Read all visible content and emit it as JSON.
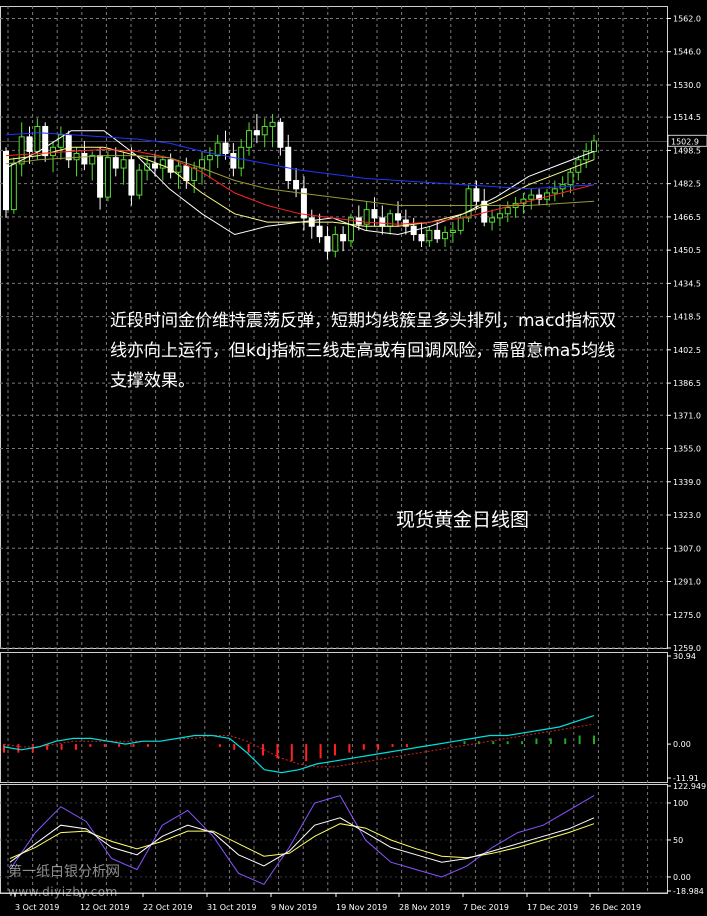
{
  "text": {
    "commentary": "近段时间金价维持震荡反弹，短期均线簇呈多头排列，macd指标双线亦向上运行，但kdj指标三线走高或有回调风险，需留意ma5均线支撑效果。",
    "caption": "现货黄金日线图",
    "watermark_name": "第一纸白银分析网",
    "watermark_url": "www.diyizby.com"
  },
  "colors": {
    "background": "#000000",
    "grid": "#7a7a7a",
    "bull_candle": "#55dd33",
    "bear_candle": "#ffffff",
    "ma_fast": "#ffffff",
    "ma_yellow": "#ffff88",
    "ma_red": "#ff2222",
    "ma_blue": "#2233ff",
    "ma_olive": "#999933",
    "macd_hist": "#ff2222",
    "macd_line": "#00e0e0",
    "macd_signal": "#cc2222",
    "kdj_k": "#ffffff",
    "kdj_d": "#ffff66",
    "kdj_j": "#8855ff"
  },
  "chart_data": [
    {
      "type": "candlestick",
      "panel": "price",
      "y_ticks": [
        "1562.0",
        "1546.0",
        "1530.0",
        "1514.5",
        "1498.5",
        "1482.5",
        "1466.5",
        "1450.5",
        "1434.5",
        "1418.5",
        "1402.5",
        "1386.5",
        "1371.0",
        "1355.0",
        "1339.0",
        "1323.0",
        "1307.0",
        "1291.0",
        "1275.0",
        "1259.0"
      ],
      "ylim": [
        1259.0,
        1568.0
      ],
      "current_price_label": "1502.9",
      "x_labels": [
        "3 Oct 2019",
        "12 Oct 2019",
        "22 Oct 2019",
        "31 Oct 2019",
        "9 Nov 2019",
        "19 Nov 2019",
        "28 Nov 2019",
        "7 Dec 2019",
        "17 Dec 2019",
        "26 Dec 2019"
      ],
      "candles": [
        [
          1498,
          1500,
          1466,
          1470
        ],
        [
          1470,
          1495,
          1468,
          1492
        ],
        [
          1492,
          1512,
          1486,
          1505
        ],
        [
          1505,
          1510,
          1492,
          1498
        ],
        [
          1498,
          1514,
          1494,
          1510
        ],
        [
          1510,
          1512,
          1493,
          1496
        ],
        [
          1496,
          1503,
          1488,
          1500
        ],
        [
          1500,
          1510,
          1494,
          1506
        ],
        [
          1506,
          1508,
          1490,
          1494
        ],
        [
          1494,
          1500,
          1486,
          1497
        ],
        [
          1497,
          1503,
          1489,
          1492
        ],
        [
          1492,
          1498,
          1484,
          1496
        ],
        [
          1496,
          1500,
          1470,
          1476
        ],
        [
          1476,
          1498,
          1474,
          1495
        ],
        [
          1495,
          1500,
          1486,
          1490
        ],
        [
          1490,
          1498,
          1482,
          1494
        ],
        [
          1494,
          1500,
          1472,
          1477
        ],
        [
          1477,
          1492,
          1475,
          1489
        ],
        [
          1489,
          1496,
          1484,
          1492
        ],
        [
          1492,
          1497,
          1486,
          1490
        ],
        [
          1490,
          1496,
          1484,
          1494
        ],
        [
          1494,
          1497,
          1485,
          1488
        ],
        [
          1488,
          1494,
          1480,
          1491
        ],
        [
          1491,
          1495,
          1480,
          1484
        ],
        [
          1484,
          1493,
          1478,
          1490
        ],
        [
          1490,
          1498,
          1482,
          1494
        ],
        [
          1494,
          1500,
          1485,
          1496
        ],
        [
          1496,
          1506,
          1490,
          1502
        ],
        [
          1502,
          1508,
          1494,
          1497
        ],
        [
          1497,
          1502,
          1486,
          1490
        ],
        [
          1490,
          1504,
          1486,
          1500
        ],
        [
          1500,
          1512,
          1496,
          1508
        ],
        [
          1508,
          1516,
          1502,
          1506
        ],
        [
          1506,
          1514,
          1500,
          1510
        ],
        [
          1510,
          1516,
          1500,
          1512
        ],
        [
          1512,
          1514,
          1496,
          1500
        ],
        [
          1500,
          1506,
          1480,
          1484
        ],
        [
          1484,
          1490,
          1476,
          1480
        ],
        [
          1480,
          1486,
          1460,
          1466
        ],
        [
          1466,
          1470,
          1456,
          1462
        ],
        [
          1462,
          1468,
          1454,
          1457
        ],
        [
          1457,
          1462,
          1446,
          1450
        ],
        [
          1450,
          1462,
          1447,
          1458
        ],
        [
          1458,
          1462,
          1450,
          1455
        ],
        [
          1455,
          1468,
          1452,
          1466
        ],
        [
          1466,
          1472,
          1460,
          1463
        ],
        [
          1463,
          1474,
          1460,
          1470
        ],
        [
          1470,
          1476,
          1462,
          1466
        ],
        [
          1466,
          1472,
          1458,
          1462
        ],
        [
          1462,
          1470,
          1458,
          1468
        ],
        [
          1468,
          1474,
          1462,
          1465
        ],
        [
          1465,
          1470,
          1458,
          1462
        ],
        [
          1462,
          1466,
          1455,
          1458
        ],
        [
          1458,
          1464,
          1452,
          1455
        ],
        [
          1455,
          1462,
          1452,
          1460
        ],
        [
          1460,
          1464,
          1454,
          1456
        ],
        [
          1456,
          1462,
          1452,
          1459
        ],
        [
          1459,
          1464,
          1454,
          1460
        ],
        [
          1460,
          1468,
          1458,
          1466
        ],
        [
          1466,
          1482,
          1464,
          1480
        ],
        [
          1480,
          1484,
          1470,
          1474
        ],
        [
          1474,
          1480,
          1462,
          1464
        ],
        [
          1464,
          1470,
          1460,
          1466
        ],
        [
          1466,
          1472,
          1462,
          1468
        ],
        [
          1468,
          1474,
          1464,
          1471
        ],
        [
          1471,
          1476,
          1466,
          1473
        ],
        [
          1473,
          1478,
          1468,
          1475
        ],
        [
          1475,
          1480,
          1470,
          1477
        ],
        [
          1477,
          1480,
          1472,
          1475
        ],
        [
          1475,
          1480,
          1472,
          1478
        ],
        [
          1478,
          1484,
          1474,
          1480
        ],
        [
          1480,
          1486,
          1476,
          1482
        ],
        [
          1482,
          1490,
          1478,
          1488
        ],
        [
          1488,
          1496,
          1484,
          1494
        ],
        [
          1494,
          1502,
          1490,
          1498
        ],
        [
          1498,
          1506,
          1494,
          1503
        ]
      ],
      "moving_averages": [
        {
          "color_key": "ma_fast",
          "values": [
            1490,
            1498,
            1508,
            1508,
            1496,
            1480,
            1468,
            1458,
            1462,
            1464,
            1466,
            1460,
            1458,
            1462,
            1468,
            1476,
            1486,
            1492,
            1498
          ]
        },
        {
          "color_key": "ma_yellow",
          "values": [
            1494,
            1496,
            1500,
            1500,
            1496,
            1490,
            1478,
            1468,
            1464,
            1464,
            1464,
            1462,
            1462,
            1464,
            1468,
            1474,
            1482,
            1488,
            1494
          ]
        },
        {
          "color_key": "ma_red",
          "values": [
            1496,
            1497,
            1498,
            1499,
            1498,
            1495,
            1488,
            1478,
            1472,
            1468,
            1466,
            1464,
            1463,
            1464,
            1466,
            1470,
            1474,
            1478,
            1482
          ]
        },
        {
          "color_key": "ma_olive",
          "values": [
            1492,
            1494,
            1495,
            1496,
            1496,
            1495,
            1490,
            1484,
            1480,
            1478,
            1476,
            1474,
            1472,
            1472,
            1472,
            1472,
            1472,
            1473,
            1474
          ]
        },
        {
          "color_key": "ma_blue",
          "values": [
            1506,
            1507,
            1506,
            1505,
            1504,
            1502,
            1498,
            1495,
            1492,
            1489,
            1487,
            1485,
            1484,
            1483,
            1482,
            1481,
            1480,
            1481,
            1482
          ]
        }
      ]
    },
    {
      "type": "line",
      "panel": "macd",
      "y_ticks": [
        "30.94",
        "0.00",
        "-11.91"
      ],
      "ylim": [
        -11.91,
        30.94
      ],
      "histogram": [
        -3,
        -3,
        -3,
        -2,
        -2,
        -2,
        -1,
        -1,
        -1,
        -1,
        -1,
        0,
        0,
        0,
        0,
        -1,
        -2,
        -3,
        -4,
        -5,
        -6,
        -6,
        -5,
        -4,
        -3,
        -2,
        -2,
        -1,
        -1,
        0,
        0,
        0,
        1,
        1,
        1,
        1,
        1,
        2,
        2,
        2,
        3,
        3
      ],
      "macd_line": [
        -1,
        -2,
        -1,
        1,
        2,
        2,
        1,
        0,
        1,
        1,
        2,
        3,
        3,
        2,
        -3,
        -9,
        -10,
        -9,
        -7,
        -6,
        -5,
        -4,
        -3,
        -2,
        -1,
        0,
        1,
        2,
        3,
        3,
        4,
        5,
        6,
        8,
        10
      ],
      "signal_line": [
        0,
        -1,
        -1,
        0,
        1,
        1,
        1,
        1,
        1,
        1,
        2,
        2,
        3,
        3,
        1,
        -2,
        -5,
        -7,
        -8,
        -8,
        -7,
        -6,
        -5,
        -4,
        -3,
        -2,
        -1,
        0,
        1,
        2,
        3,
        4,
        5,
        6,
        7
      ]
    },
    {
      "type": "line",
      "panel": "kdj",
      "y_ticks": [
        "122.949",
        "100",
        "50",
        "0.00",
        "-18.984"
      ],
      "ylim": [
        -18.984,
        122.949
      ],
      "k": [
        20,
        45,
        70,
        65,
        40,
        30,
        55,
        70,
        60,
        30,
        15,
        35,
        70,
        80,
        60,
        40,
        30,
        20,
        25,
        35,
        45,
        55,
        65,
        80
      ],
      "d": [
        25,
        40,
        60,
        62,
        48,
        38,
        48,
        62,
        62,
        45,
        28,
        32,
        55,
        72,
        66,
        50,
        38,
        28,
        26,
        32,
        40,
        50,
        60,
        72
      ],
      "j": [
        10,
        60,
        95,
        75,
        25,
        10,
        70,
        90,
        55,
        5,
        -10,
        40,
        100,
        110,
        50,
        20,
        10,
        0,
        15,
        40,
        60,
        70,
        90,
        110
      ]
    }
  ]
}
